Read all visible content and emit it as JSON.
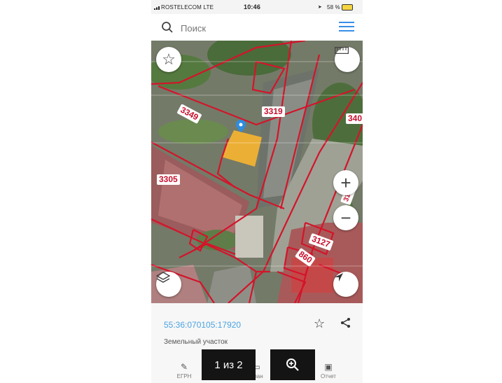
{
  "status_bar": {
    "carrier": "ROSTELECOM  LTE",
    "time": "10:46",
    "battery": "58 %"
  },
  "search": {
    "placeholder": "Поиск"
  },
  "map": {
    "parcel_labels": [
      "3349",
      "3319",
      "340",
      "3305",
      "3127",
      "860",
      "3110"
    ],
    "highlight_color": "#f2b233",
    "boundary_color": "#d4142a"
  },
  "parcel": {
    "cadastral_number": "55:36:070105:17920",
    "type": "Земельный участок"
  },
  "tabs": [
    {
      "label": "ЕГРН",
      "icon": "pencil-icon"
    },
    {
      "label": "План",
      "icon": "plan-icon"
    },
    {
      "label": "Отчет",
      "icon": "report-icon"
    }
  ],
  "overlay": {
    "page_counter": "1 из 2"
  }
}
